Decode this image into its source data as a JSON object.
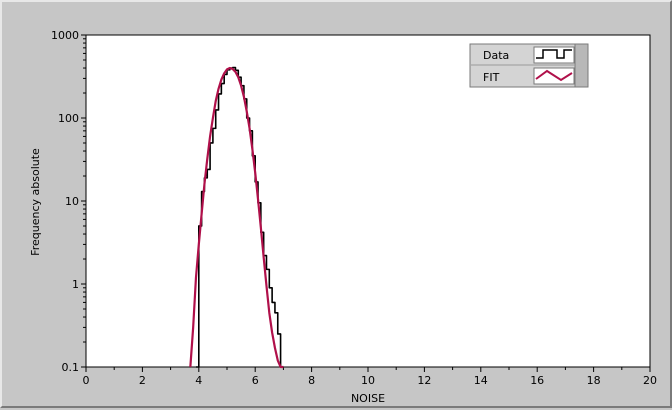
{
  "chart_data": {
    "type": "line",
    "scale_y": "log",
    "xlabel": "NOISE",
    "ylabel": "Frequency absolute",
    "xlim": [
      0,
      20
    ],
    "ylim": [
      0.1,
      1000
    ],
    "x_ticks": [
      "0",
      "2",
      "4",
      "6",
      "8",
      "10",
      "12",
      "14",
      "16",
      "18",
      "20"
    ],
    "y_ticks": [
      "0.1",
      "1",
      "10",
      "100",
      "1000"
    ],
    "grid": false,
    "legend_position": "top-right",
    "series": [
      {
        "name": "Data",
        "style": "step",
        "color": "#000000",
        "x": [
          3.9,
          4.0,
          4.1,
          4.2,
          4.3,
          4.4,
          4.5,
          4.6,
          4.7,
          4.8,
          4.9,
          5.0,
          5.1,
          5.2,
          5.3,
          5.4,
          5.5,
          5.6,
          5.7,
          5.8,
          5.9,
          6.0,
          6.1,
          6.2,
          6.3,
          6.4,
          6.5,
          6.6,
          6.7,
          6.8,
          6.9,
          7.0
        ],
        "y": [
          0.1,
          5,
          13,
          19,
          24,
          50,
          75,
          125,
          195,
          260,
          335,
          380,
          400,
          405,
          375,
          310,
          245,
          170,
          100,
          70,
          35,
          17,
          9.5,
          4.2,
          2.2,
          1.5,
          0.9,
          0.6,
          0.45,
          0.25,
          0.1,
          0.1
        ]
      },
      {
        "name": "FIT",
        "style": "line",
        "color": "#b0104a",
        "x": [
          3.7,
          3.8,
          3.9,
          4.0,
          4.1,
          4.2,
          4.3,
          4.4,
          4.5,
          4.6,
          4.7,
          4.8,
          4.9,
          5.0,
          5.1,
          5.2,
          5.3,
          5.4,
          5.5,
          5.6,
          5.7,
          5.8,
          5.9,
          6.0,
          6.1,
          6.2,
          6.3,
          6.4,
          6.5,
          6.6,
          6.7,
          6.8,
          6.9,
          7.0
        ],
        "y": [
          0.1,
          0.3,
          1.2,
          3.0,
          7.0,
          16,
          32,
          60,
          100,
          160,
          225,
          290,
          345,
          385,
          400,
          390,
          360,
          310,
          245,
          180,
          120,
          75,
          42,
          22,
          10.5,
          4.8,
          2.1,
          0.95,
          0.45,
          0.26,
          0.17,
          0.12,
          0.1,
          0.1
        ]
      }
    ],
    "legend": [
      {
        "label": "Data",
        "icon": "step-line-icon",
        "color": "#000000"
      },
      {
        "label": "FIT",
        "icon": "zigzag-line-icon",
        "color": "#b0104a"
      }
    ]
  }
}
